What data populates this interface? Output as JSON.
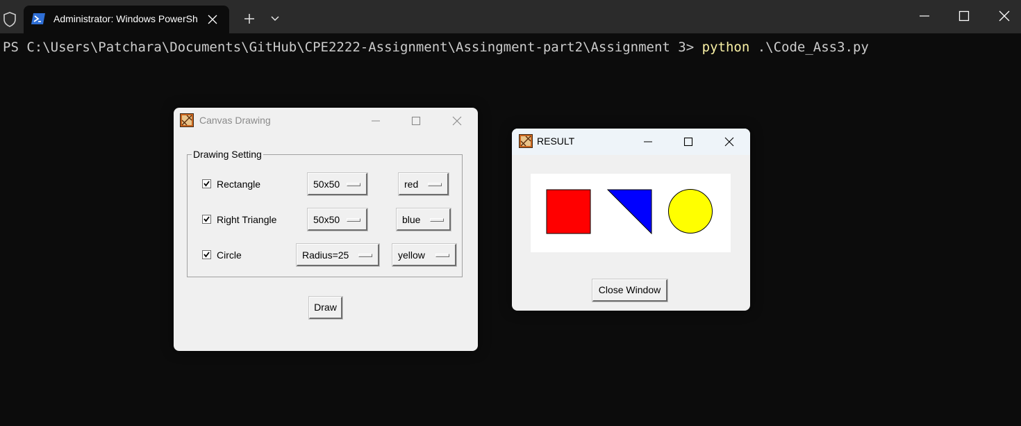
{
  "terminal": {
    "tab_title": "Administrator: Windows PowerShell",
    "prompt": "PS C:\\Users\\Patchara\\Documents\\GitHub\\CPE2222-Assignment\\Assingment-part2\\Assignment 3> ",
    "command": "python",
    "args": " .\\Code_Ass3.py",
    "icons": [
      "shield-icon",
      "powershell-icon",
      "close-icon",
      "plus-icon",
      "chevron-down-icon",
      "minimize-icon",
      "maximize-icon",
      "close-icon"
    ]
  },
  "drawing_window": {
    "title": "Canvas Drawing",
    "group_label": "Drawing Setting",
    "rows": [
      {
        "label": "Rectangle",
        "checked": true,
        "size": "50x50",
        "color": "red"
      },
      {
        "label": "Right Triangle",
        "checked": true,
        "size": "50x50",
        "color": "blue"
      },
      {
        "label": "Circle",
        "checked": true,
        "size": "Radius=25",
        "color": "yellow"
      }
    ],
    "draw_button": "Draw"
  },
  "result_window": {
    "title": "RESULT",
    "shapes": [
      {
        "shape": "rectangle",
        "fill": "#ff0000"
      },
      {
        "shape": "right-triangle",
        "fill": "#0000ff"
      },
      {
        "shape": "circle",
        "fill": "#ffff00"
      }
    ],
    "close_button": "Close Window"
  },
  "colors": {
    "terminal_bg": "#0c0c0c",
    "tabbar_bg": "#2b2b2b",
    "command_highlight": "#f9f1a5",
    "window_bg": "#f0f0f0"
  }
}
